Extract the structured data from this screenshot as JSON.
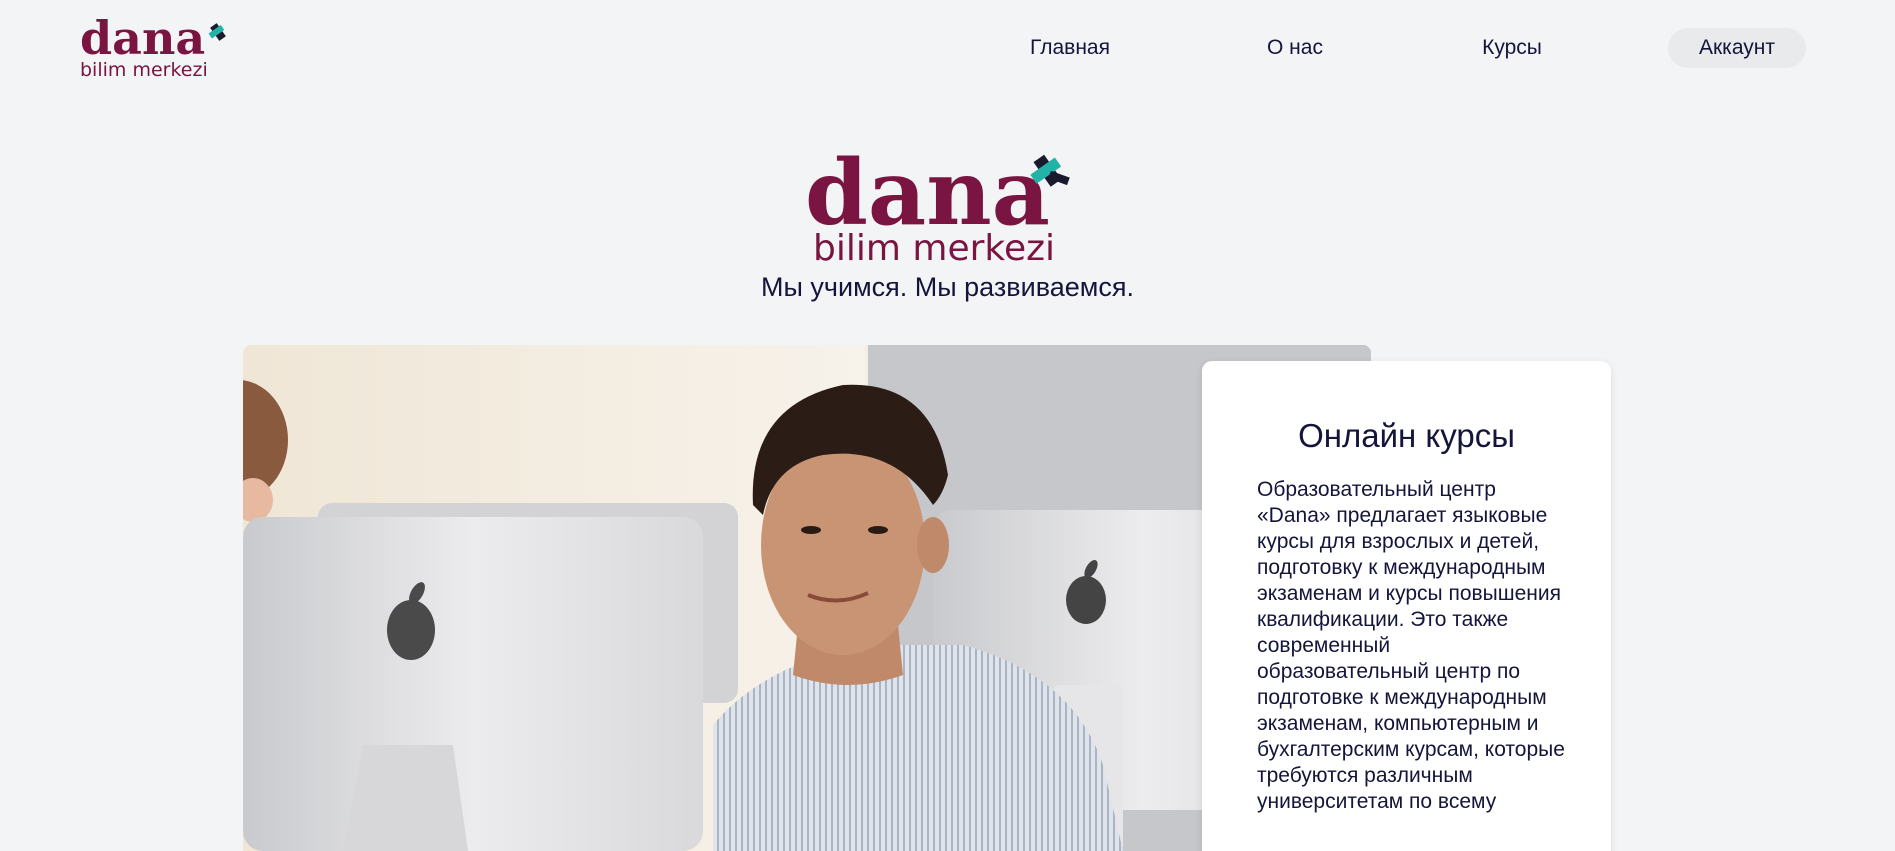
{
  "brand": {
    "name": "dana",
    "sub": "bilim merkezi",
    "colors": {
      "primary": "#7a1541",
      "accent": "#22b3a8"
    }
  },
  "nav": {
    "home": "Главная",
    "about": "О нас",
    "courses": "Курсы",
    "account": "Аккаунт"
  },
  "hero": {
    "tagline": "Мы учимся. Мы развиваемся.",
    "image_alt": "student-at-computer"
  },
  "card": {
    "title": "Онлайн курсы",
    "text": "Образовательный центр «Dana» предлагает языковые курсы для взрослых и детей, подго­товку к международным экзаменам и курсы повышения квалификации. Это также современный образовательный центр по подготовке к междуна­родным экзаменам, компьютерным и бух­галтерским курсам, которые требуются различным университетам по всему"
  }
}
